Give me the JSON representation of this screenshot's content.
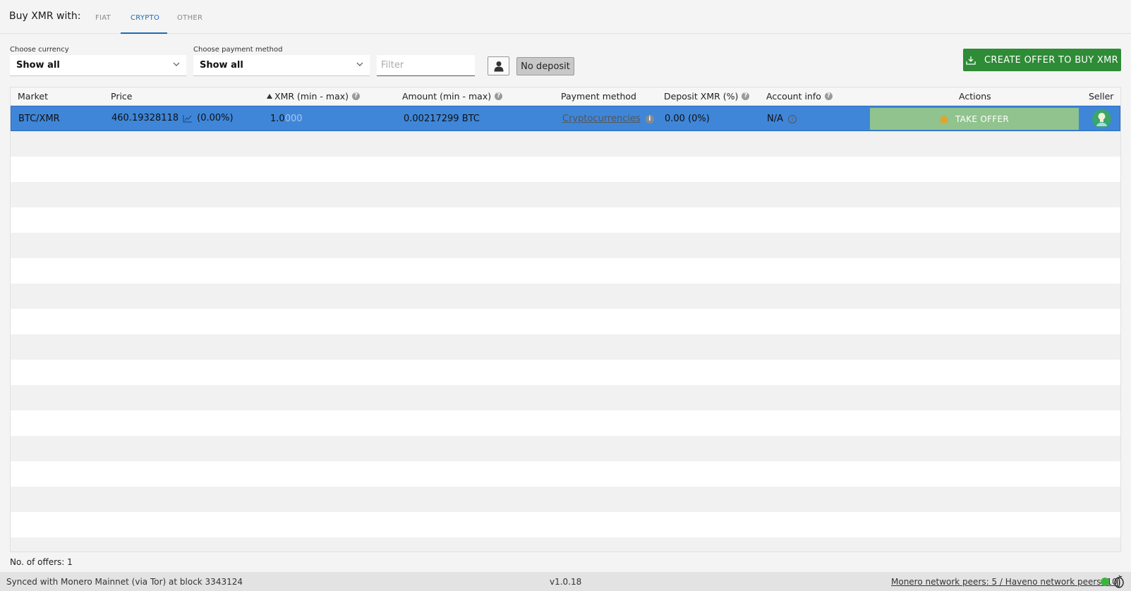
{
  "header": {
    "title": "Buy XMR with:",
    "tabs": [
      {
        "label": "FIAT",
        "active": false
      },
      {
        "label": "CRYPTO",
        "active": true
      },
      {
        "label": "OTHER",
        "active": false
      }
    ]
  },
  "filters": {
    "currency_label": "Choose currency",
    "currency_value": "Show all",
    "payment_label": "Choose payment method",
    "payment_value": "Show all",
    "filter_placeholder": "Filter",
    "no_deposit_label": "No deposit",
    "create_offer_label": "CREATE OFFER TO BUY XMR"
  },
  "table": {
    "columns": [
      {
        "label": "Market"
      },
      {
        "label": "Price"
      },
      {
        "label": "XMR (min - max)"
      },
      {
        "label": "Amount (min - max)"
      },
      {
        "label": "Payment method"
      },
      {
        "label": "Deposit XMR (%)"
      },
      {
        "label": "Account info"
      },
      {
        "label": "Actions"
      },
      {
        "label": "Seller"
      }
    ],
    "rows": [
      {
        "market": "BTC/XMR",
        "price": "460.19328118",
        "price_change": "(0.00%)",
        "xmr_main": "1.0",
        "xmr_faded": "000",
        "amount": "0.00217299 BTC",
        "payment_method": "Cryptocurrencies",
        "deposit": "0.00 (0%)",
        "account_info": "N/A",
        "action": "TAKE OFFER"
      }
    ]
  },
  "offers_count": "No. of offers: 1",
  "status": {
    "sync": "Synced with Monero Mainnet (via Tor) at block 3343124",
    "version": "v1.0.18",
    "peers": "Monero network peers: 5 / Haveno network peers: 10"
  },
  "colors": {
    "accent_blue": "#1c6bb5",
    "selected_row": "#3f86d9",
    "create_green": "#2e8b36",
    "take_green": "#90c38d",
    "status_dot": "#3bb53b"
  }
}
